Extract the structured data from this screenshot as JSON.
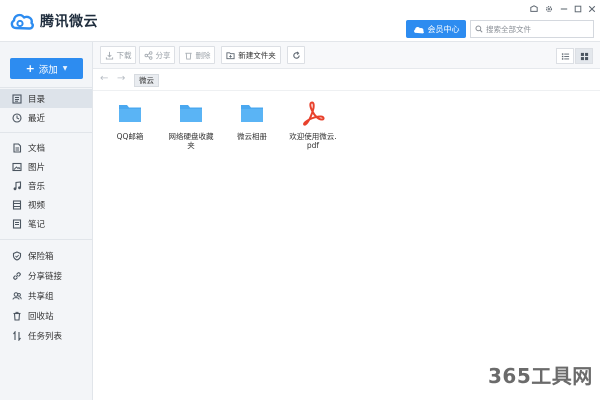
{
  "app": {
    "name": "腾讯微云"
  },
  "header": {
    "vip_label": "会员中心",
    "search_placeholder": "搜索全部文件"
  },
  "sidebar": {
    "upload_label": "添加",
    "items": [
      {
        "label": "目录",
        "icon": "catalog-icon"
      },
      {
        "label": "最近",
        "icon": "clock-icon"
      },
      {
        "label": "文档",
        "icon": "document-icon"
      },
      {
        "label": "图片",
        "icon": "image-icon"
      },
      {
        "label": "音乐",
        "icon": "music-icon"
      },
      {
        "label": "视频",
        "icon": "video-icon"
      },
      {
        "label": "笔记",
        "icon": "note-icon"
      },
      {
        "label": "保险箱",
        "icon": "shield-icon"
      },
      {
        "label": "分享链接",
        "icon": "link-icon"
      },
      {
        "label": "共享组",
        "icon": "group-icon"
      },
      {
        "label": "回收站",
        "icon": "trash-icon"
      },
      {
        "label": "任务列表",
        "icon": "transfer-icon"
      }
    ]
  },
  "toolbar": {
    "download": "下载",
    "share": "分享",
    "delete": "删除",
    "new_folder": "新建文件夹"
  },
  "breadcrumb": {
    "current": "微云"
  },
  "files": [
    {
      "name": "QQ邮箱",
      "type": "folder"
    },
    {
      "name": "网络硬盘收藏夹",
      "type": "folder"
    },
    {
      "name": "微云相册",
      "type": "folder"
    },
    {
      "name": "欢迎使用微云.pdf",
      "type": "pdf"
    }
  ],
  "colors": {
    "accent": "#2d8cf0",
    "folder": "#4aa8f0",
    "pdf": "#e8412c"
  },
  "watermark": "365工具网"
}
